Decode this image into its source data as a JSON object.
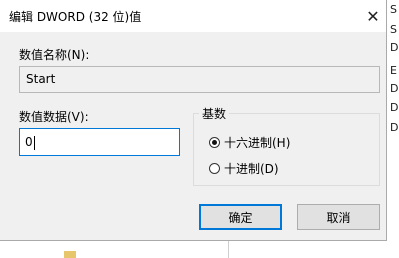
{
  "dialog": {
    "title": "编辑 DWORD (32 位)值",
    "close_glyph": "✕",
    "value_name_label": "数值名称(N):",
    "value_name": "Start",
    "value_data_label": "数值数据(V):",
    "value_data": "0",
    "base_group_title": "基数",
    "radio_hex_label": "十六进制(H)",
    "radio_hex_selected": true,
    "radio_dec_label": "十进制(D)",
    "radio_dec_selected": false,
    "ok_label": "确定",
    "cancel_label": "取消"
  },
  "background_letters": [
    "S",
    "S",
    "D",
    "E",
    "D",
    "D",
    "D"
  ],
  "colors": {
    "accent": "#0078d7",
    "dialog_bg": "#f0f0f0"
  }
}
